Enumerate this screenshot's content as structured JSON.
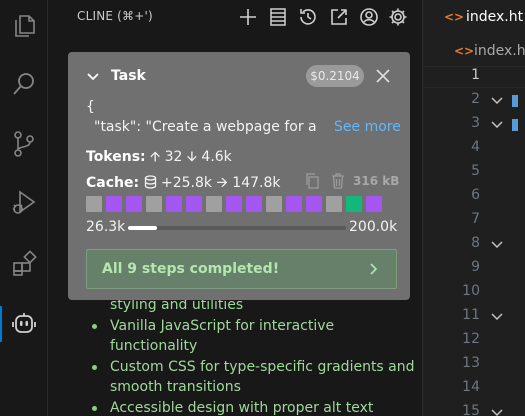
{
  "side_panel": {
    "title": "CLINE (⌘+')"
  },
  "task": {
    "title": "Task",
    "cost": "$0.2104",
    "json_open": "{",
    "json_line": "\"task\": \"Create a webpage for a",
    "see_more": "See more",
    "tokens_label": "Tokens:",
    "tokens_up": "32",
    "tokens_down": "4.6k",
    "cache_label": "Cache:",
    "cache_write": "+25.8k",
    "cache_read": "147.8k",
    "size": "316 kB",
    "cells": [
      "#a0a0a0",
      "#a456f0",
      "#a456f0",
      "#a0a0a0",
      "#a456f0",
      "#a456f0",
      "#a0a0a0",
      "#a456f0",
      "#a456f0",
      "#a0a0a0",
      "#a456f0",
      "#a456f0",
      "#a0a0a0",
      "#12b77a",
      "#a456f0"
    ],
    "context_used": "26.3k",
    "context_max": "200.0k",
    "context_fraction": 0.1315,
    "completed": "All 9 steps completed!"
  },
  "background_list": {
    "partial_item": "styling and utilities",
    "items": [
      "Vanilla JavaScript for interactive functionality",
      "Custom CSS for type-specific gradients and smooth transitions",
      "Accessible design with proper alt text"
    ]
  },
  "editor": {
    "tab_icon": "<>",
    "tab_label": "index.ht",
    "breadcrumb_icon": "<>",
    "breadcrumb": "index.ht",
    "line_numbers": [
      "1",
      "2",
      "3",
      "4",
      "5",
      "6",
      "7",
      "8",
      "9",
      "10",
      "11",
      "12",
      "13",
      "14",
      "15"
    ]
  },
  "colors": {
    "accent": "#0078d4",
    "link": "#5fb8ff",
    "success_text": "#b6e6b0",
    "html_icon": "#e37933"
  }
}
